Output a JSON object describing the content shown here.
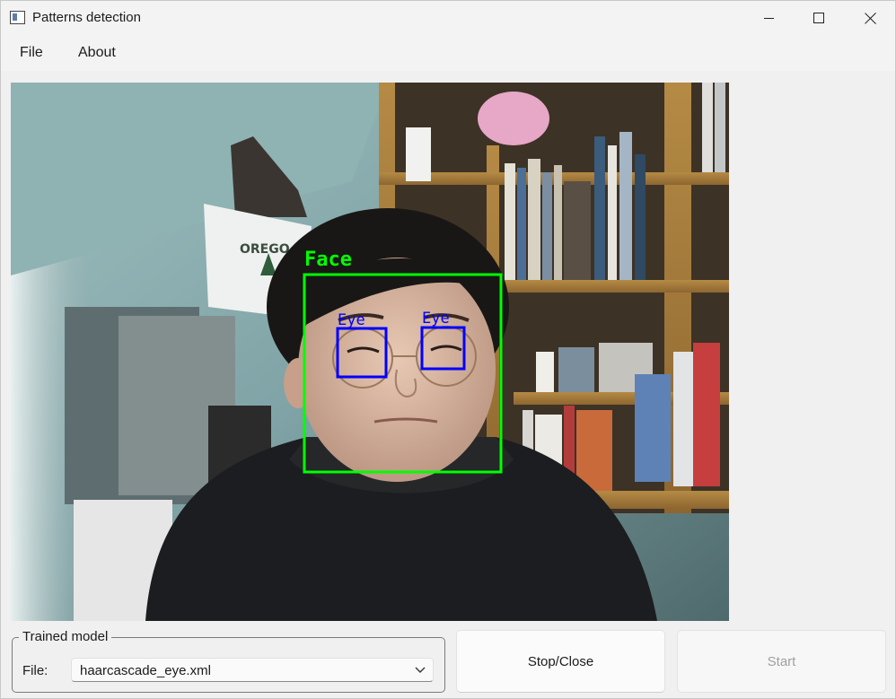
{
  "window": {
    "title": "Patterns detection",
    "controls": {
      "minimize": "minimize-icon",
      "maximize": "maximize-icon",
      "close": "close-icon"
    }
  },
  "menu": {
    "items": [
      {
        "label": "File"
      },
      {
        "label": "About"
      }
    ]
  },
  "camera": {
    "detections": [
      {
        "label": "Face",
        "color": "#00ff00"
      },
      {
        "label": "Eye",
        "color": "#0000ff"
      },
      {
        "label": "Eye",
        "color": "#0000ff"
      }
    ],
    "background_text": "OREGO"
  },
  "trained_model": {
    "group_title": "Trained model",
    "file_label": "File:",
    "selected_file": "haarcascade_eye.xml"
  },
  "buttons": {
    "stop_close": "Stop/Close",
    "start": "Start"
  },
  "colors": {
    "face_box": "#00ff00",
    "eye_box": "#0000ff",
    "disabled_text": "#a0a0a0"
  }
}
